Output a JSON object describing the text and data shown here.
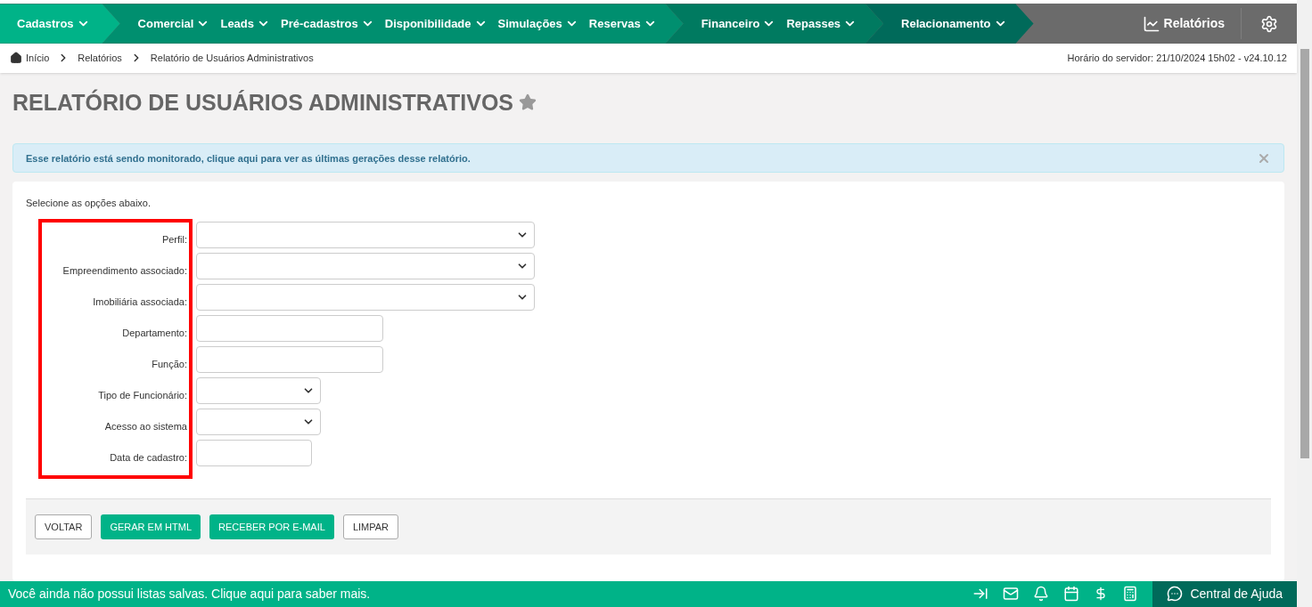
{
  "nav": {
    "groups": [
      {
        "items": [
          {
            "label": "Cadastros"
          }
        ]
      },
      {
        "items": [
          {
            "label": "Comercial"
          },
          {
            "label": "Leads"
          },
          {
            "label": "Pré-cadastros"
          },
          {
            "label": "Disponibilidade"
          },
          {
            "label": "Simulações"
          },
          {
            "label": "Reservas"
          }
        ]
      },
      {
        "items": [
          {
            "label": "Financeiro"
          },
          {
            "label": "Repasses"
          }
        ]
      },
      {
        "items": [
          {
            "label": "Relacionamento"
          }
        ]
      }
    ],
    "reports_link": "Relatórios"
  },
  "breadcrumb": [
    "Início",
    "Relatórios",
    "Relatório de Usuários Administrativos"
  ],
  "server_time": "Horário do servidor: 21/10/2024 15h02 - v24.10.12",
  "page_title": "RELATÓRIO DE USUÁRIOS ADMINISTRATIVOS",
  "favorite": false,
  "alert": "Esse relatório está sendo monitorado, clique aqui para ver as últimas gerações desse relatório.",
  "form": {
    "intro": "Selecione as opções abaixo.",
    "fields": [
      {
        "label": "Perfil:",
        "kind": "dropdown"
      },
      {
        "label": "Empreendimento associado:",
        "kind": "dropdown"
      },
      {
        "label": "Imobiliária associada:",
        "kind": "dropdown"
      },
      {
        "label": "Departamento:",
        "kind": "text"
      },
      {
        "label": "Função:",
        "kind": "text"
      },
      {
        "label": "Tipo de Funcionário:",
        "kind": "compact"
      },
      {
        "label": "Acesso ao sistema",
        "kind": "compact"
      },
      {
        "label": "Data de cadastro:",
        "kind": "date"
      }
    ],
    "buttons": [
      {
        "label": "VOLTAR",
        "primary": false
      },
      {
        "label": "GERAR EM HTML",
        "primary": true
      },
      {
        "label": "RECEBER POR E-MAIL",
        "primary": true
      },
      {
        "label": "LIMPAR",
        "primary": false
      }
    ]
  },
  "status_bar": {
    "message": "Você ainda não possui listas salvas. Clique aqui para saber mais.",
    "help": "Central de Ajuda"
  }
}
